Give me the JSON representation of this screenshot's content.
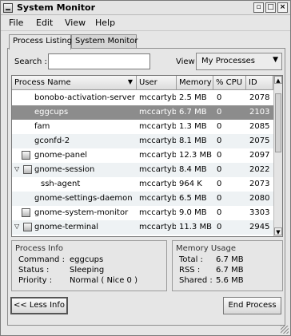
{
  "window": {
    "title": "System Monitor",
    "controls": {
      "minimize": "▫",
      "maximize": "□",
      "close": "×"
    }
  },
  "menubar": [
    "File",
    "Edit",
    "View",
    "Help"
  ],
  "tabs": [
    "Process Listing",
    "System Monitor"
  ],
  "toolbar": {
    "search_label": "Search :",
    "search_value": "",
    "view_label": "View",
    "view_value": "My Processes"
  },
  "table": {
    "columns": [
      "Process Name",
      "User",
      "Memory",
      "% CPU",
      "ID"
    ],
    "rows": [
      {
        "name": "bonobo-activation-server",
        "user": "mccartyb",
        "memory": "2.5 MB",
        "cpu": "0",
        "id": "2078",
        "selected": false,
        "expander": "",
        "icon": false,
        "indent": 0
      },
      {
        "name": "eggcups",
        "user": "mccartyb",
        "memory": "6.7 MB",
        "cpu": "0",
        "id": "2103",
        "selected": true,
        "expander": "",
        "icon": false,
        "indent": 0
      },
      {
        "name": "fam",
        "user": "mccartyb",
        "memory": "1.3 MB",
        "cpu": "0",
        "id": "2085",
        "selected": false,
        "expander": "",
        "icon": false,
        "indent": 0
      },
      {
        "name": "gconfd-2",
        "user": "mccartyb",
        "memory": "8.1 MB",
        "cpu": "0",
        "id": "2075",
        "selected": false,
        "expander": "",
        "icon": false,
        "indent": 0
      },
      {
        "name": "gnome-panel",
        "user": "mccartyb",
        "memory": "12.3 MB",
        "cpu": "0",
        "id": "2097",
        "selected": false,
        "expander": "",
        "icon": true,
        "indent": 0
      },
      {
        "name": "gnome-session",
        "user": "mccartyb",
        "memory": "8.4 MB",
        "cpu": "0",
        "id": "2022",
        "selected": false,
        "expander": "▽",
        "icon": true,
        "indent": 0
      },
      {
        "name": "ssh-agent",
        "user": "mccartyb",
        "memory": "964 K",
        "cpu": "0",
        "id": "2073",
        "selected": false,
        "expander": "",
        "icon": false,
        "indent": 1
      },
      {
        "name": "gnome-settings-daemon",
        "user": "mccartyb",
        "memory": "6.5 MB",
        "cpu": "0",
        "id": "2080",
        "selected": false,
        "expander": "",
        "icon": false,
        "indent": 0
      },
      {
        "name": "gnome-system-monitor",
        "user": "mccartyb",
        "memory": "9.0 MB",
        "cpu": "0",
        "id": "3303",
        "selected": false,
        "expander": "",
        "icon": true,
        "indent": 0
      },
      {
        "name": "gnome-terminal",
        "user": "mccartyb",
        "memory": "11.3 MB",
        "cpu": "0",
        "id": "2945",
        "selected": false,
        "expander": "▽",
        "icon": true,
        "indent": 0
      }
    ]
  },
  "process_info": {
    "title": "Process Info",
    "command_label": "Command :",
    "command_value": "eggcups",
    "status_label": "Status :",
    "status_value": "Sleeping",
    "priority_label": "Priority :",
    "priority_value": "Normal  ( Nice 0 )"
  },
  "memory_usage": {
    "title": "Memory Usage",
    "total_label": "Total :",
    "total_value": "6.7 MB",
    "rss_label": "RSS :",
    "rss_value": "6.7 MB",
    "shared_label": "Shared :",
    "shared_value": "5.6 MB"
  },
  "buttons": {
    "less_info": "<< Less Info",
    "end_process": "End Process"
  }
}
